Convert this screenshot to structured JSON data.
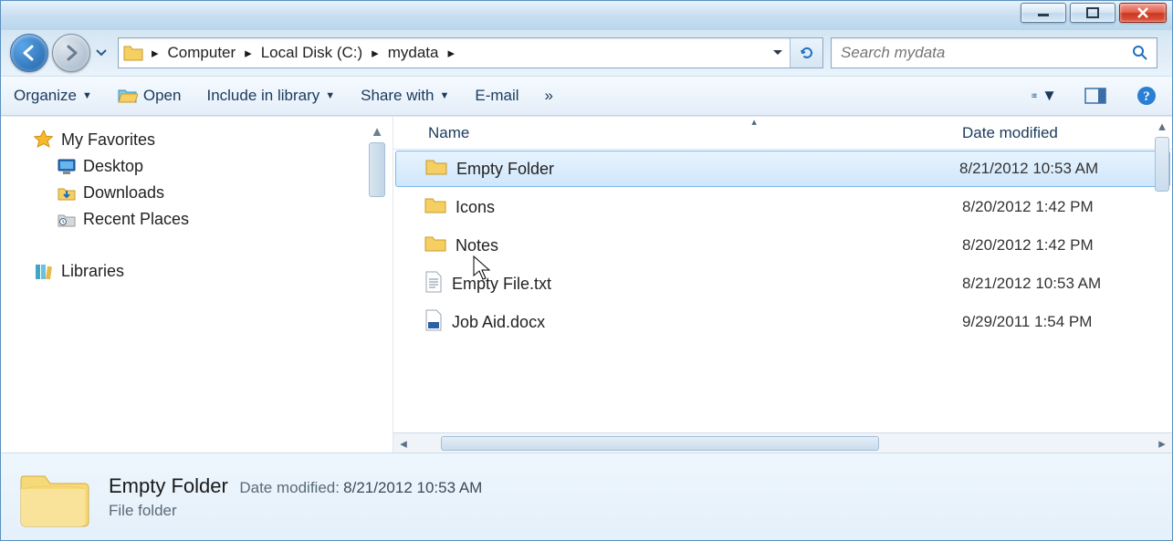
{
  "breadcrumb": [
    "Computer",
    "Local Disk (C:)",
    "mydata"
  ],
  "search": {
    "placeholder": "Search mydata"
  },
  "toolbar": {
    "organize": "Organize",
    "open": "Open",
    "include": "Include in library",
    "share": "Share with",
    "email": "E-mail",
    "more": "»"
  },
  "sidebar": {
    "favorites": "My Favorites",
    "items": [
      {
        "label": "Desktop"
      },
      {
        "label": "Downloads"
      },
      {
        "label": "Recent Places"
      }
    ],
    "libraries": "Libraries"
  },
  "columns": {
    "name": "Name",
    "date": "Date modified"
  },
  "rows": [
    {
      "name": "Empty Folder",
      "date": "8/21/2012 10:53 AM",
      "type": "folder",
      "selected": true
    },
    {
      "name": "Icons",
      "date": "8/20/2012 1:42 PM",
      "type": "folder",
      "selected": false
    },
    {
      "name": "Notes",
      "date": "8/20/2012 1:42 PM",
      "type": "folder",
      "selected": false
    },
    {
      "name": "Empty File.txt",
      "date": "8/21/2012 10:53 AM",
      "type": "txt",
      "selected": false
    },
    {
      "name": "Job Aid.docx",
      "date": "9/29/2011 1:54 PM",
      "type": "docx",
      "selected": false
    }
  ],
  "details": {
    "title": "Empty Folder",
    "meta_label": "Date modified:",
    "meta_value": "8/21/2012 10:53 AM",
    "subtitle": "File folder"
  }
}
